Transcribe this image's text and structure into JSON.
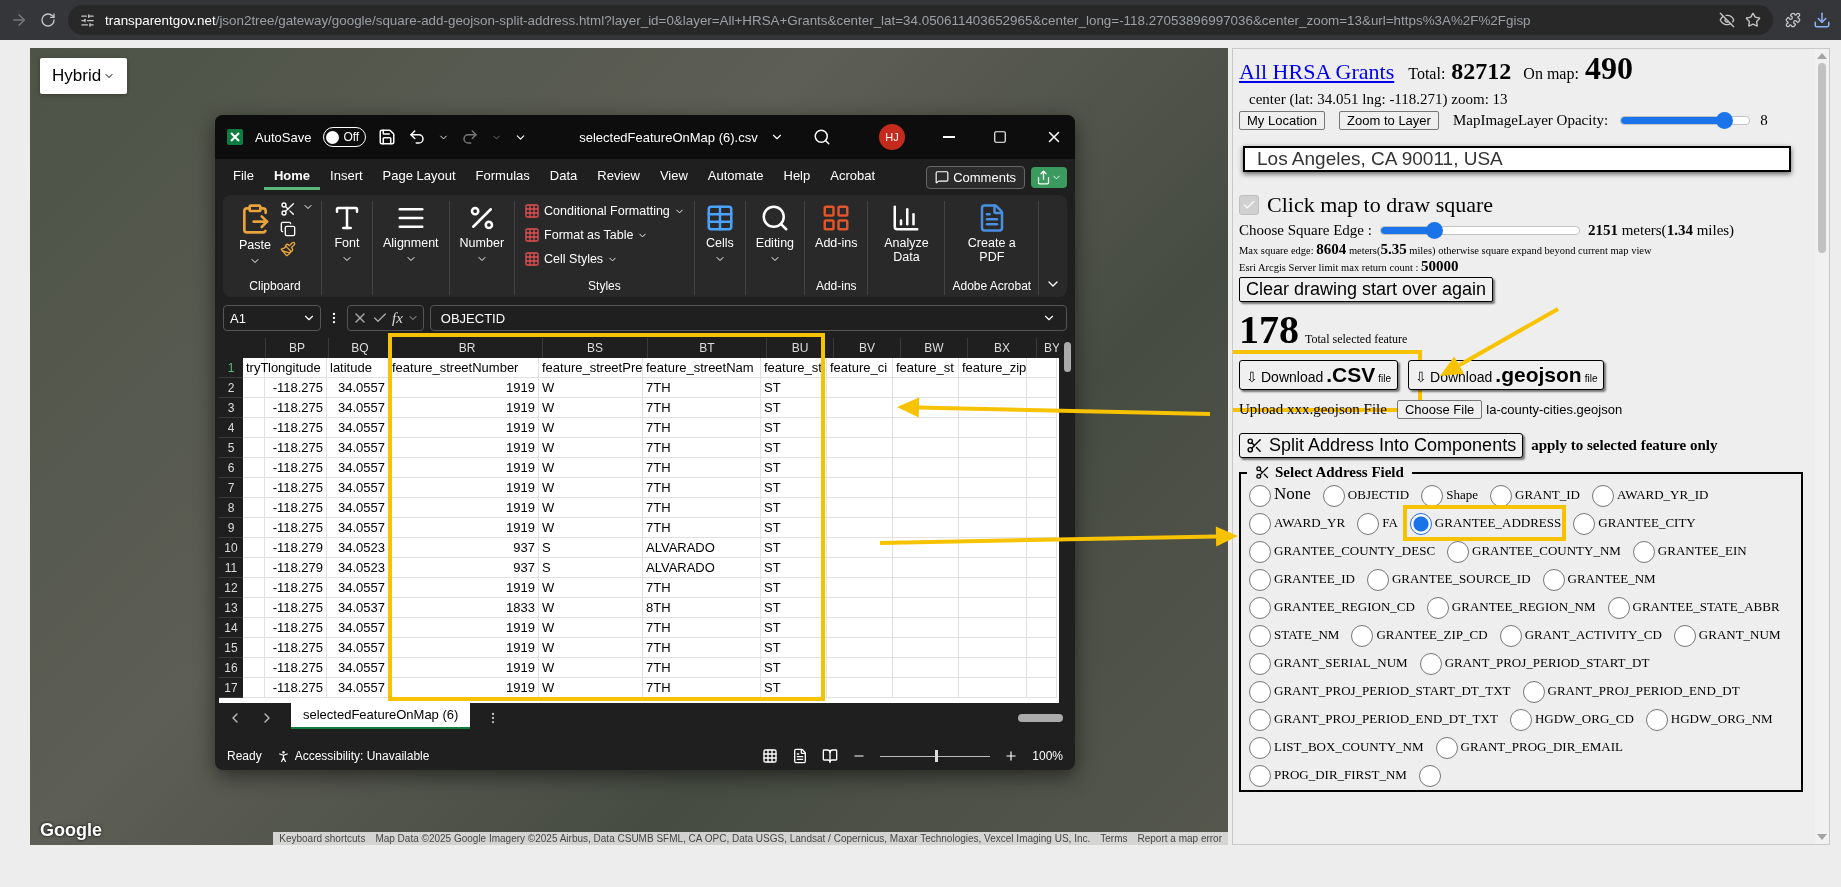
{
  "browser": {
    "host": "transparentgov.net",
    "path": "/json2tree/gateway/google/square-add-geojson-split-address.html?layer_id=0&layer=All+HRSA+Grants&center_lat=34.050611403652965&center_long=-118.27053896997036&center_zoom=13&url=https%3A%2F%2Fgisp"
  },
  "map": {
    "type_button": "Hybrid",
    "logo": "Google",
    "attribution": [
      "Keyboard shortcuts",
      "Map Data ©2025 Google Imagery ©2025 Airbus, Data CSUMB SFML, CA OPC, Data USGS, Landsat / Copernicus, Maxar Technologies, Vexcel Imaging US, Inc.",
      "Terms",
      "Report a map error"
    ]
  },
  "excel": {
    "autosave": {
      "label": "AutoSave",
      "toggle": "Off",
      "on": false
    },
    "file_name": "selectedFeatureOnMap (6).csv",
    "avatar": "HJ",
    "tabs": [
      {
        "label": "File",
        "selected": false
      },
      {
        "label": "Home",
        "selected": true
      },
      {
        "label": "Insert",
        "selected": false
      },
      {
        "label": "Page Layout",
        "selected": false
      },
      {
        "label": "Formulas",
        "selected": false
      },
      {
        "label": "Data",
        "selected": false
      },
      {
        "label": "Review",
        "selected": false
      },
      {
        "label": "View",
        "selected": false
      },
      {
        "label": "Automate",
        "selected": false
      },
      {
        "label": "Help",
        "selected": false
      },
      {
        "label": "Acrobat",
        "selected": false
      }
    ],
    "comments_button": "Comments",
    "ribbon": [
      {
        "kind": "clipboard",
        "button": "Paste",
        "label": "Clipboard"
      },
      {
        "kind": "font",
        "button": "Font"
      },
      {
        "kind": "alignment",
        "button": "Alignment"
      },
      {
        "kind": "number",
        "button": "Number"
      },
      {
        "kind": "styles",
        "items": [
          "Conditional Formatting",
          "Format as Table",
          "Cell Styles"
        ],
        "label": "Styles"
      },
      {
        "kind": "cells",
        "button": "Cells"
      },
      {
        "kind": "editing",
        "button": "Editing"
      },
      {
        "kind": "addins",
        "button": "Add-ins",
        "label": "Add-ins"
      },
      {
        "kind": "analyze",
        "button": "Analyze Data"
      },
      {
        "kind": "pdf",
        "button": "Create a PDF",
        "label": "Adobe Acrobat"
      }
    ],
    "formula_bar": {
      "name_box": "A1",
      "fx": "fx",
      "value": "OBJECTID"
    },
    "column_letters": [
      "BP",
      "BQ",
      "BR",
      "BS",
      "BT",
      "BU",
      "BV",
      "BW",
      "BX",
      "BY"
    ],
    "rows": [
      {
        "number": "1",
        "cells": [
          "tryT",
          "longitude",
          "latitude",
          "feature_streetNumber",
          "feature_streetPre",
          "feature_streetNam",
          "feature_st",
          "feature_ci",
          "feature_st",
          "feature_zip"
        ]
      },
      {
        "number": "2",
        "cells": [
          null,
          "-118.275",
          "34.0557",
          "1919",
          "W",
          "7TH",
          "ST"
        ]
      },
      {
        "number": "3",
        "cells": [
          null,
          "-118.275",
          "34.0557",
          "1919",
          "W",
          "7TH",
          "ST"
        ]
      },
      {
        "number": "4",
        "cells": [
          null,
          "-118.275",
          "34.0557",
          "1919",
          "W",
          "7TH",
          "ST"
        ]
      },
      {
        "number": "5",
        "cells": [
          null,
          "-118.275",
          "34.0557",
          "1919",
          "W",
          "7TH",
          "ST"
        ]
      },
      {
        "number": "6",
        "cells": [
          null,
          "-118.275",
          "34.0557",
          "1919",
          "W",
          "7TH",
          "ST"
        ]
      },
      {
        "number": "7",
        "cells": [
          null,
          "-118.275",
          "34.0557",
          "1919",
          "W",
          "7TH",
          "ST"
        ]
      },
      {
        "number": "8",
        "cells": [
          null,
          "-118.275",
          "34.0557",
          "1919",
          "W",
          "7TH",
          "ST"
        ]
      },
      {
        "number": "9",
        "cells": [
          null,
          "-118.275",
          "34.0557",
          "1919",
          "W",
          "7TH",
          "ST"
        ]
      },
      {
        "number": "10",
        "cells": [
          null,
          "-118.279",
          "34.0523",
          "937",
          "S",
          "ALVARADO",
          "ST"
        ]
      },
      {
        "number": "11",
        "cells": [
          null,
          "-118.279",
          "34.0523",
          "937",
          "S",
          "ALVARADO",
          "ST"
        ]
      },
      {
        "number": "12",
        "cells": [
          null,
          "-118.275",
          "34.0557",
          "1919",
          "W",
          "7TH",
          "ST"
        ]
      },
      {
        "number": "13",
        "cells": [
          null,
          "-118.275",
          "34.0537",
          "1833",
          "W",
          "8TH",
          "ST"
        ]
      },
      {
        "number": "14",
        "cells": [
          null,
          "-118.275",
          "34.0557",
          "1919",
          "W",
          "7TH",
          "ST"
        ]
      },
      {
        "number": "15",
        "cells": [
          null,
          "-118.275",
          "34.0557",
          "1919",
          "W",
          "7TH",
          "ST"
        ]
      },
      {
        "number": "16",
        "cells": [
          null,
          "-118.275",
          "34.0557",
          "1919",
          "W",
          "7TH",
          "ST"
        ]
      },
      {
        "number": "17",
        "cells": [
          null,
          "-118.275",
          "34.0557",
          "1919",
          "W",
          "7TH",
          "ST"
        ]
      }
    ],
    "sheet_tab": "selectedFeatureOnMap (6)",
    "status": {
      "ready": "Ready",
      "accessibility": "Accessibility: Unavailable",
      "zoom": "100%",
      "level": 0.5
    }
  },
  "panel": {
    "layer_link": "All HRSA Grants",
    "total_label": "Total:",
    "total": "82712",
    "on_map_label": "On map:",
    "on_map": "490",
    "center": "center (lat: 34.051 lng: -118.271) zoom: 13",
    "buttons": [
      "My Location",
      "Zoom to Layer"
    ],
    "opacity": {
      "label": "MapImageLayer Opacity:",
      "level": 0.8,
      "reading": "8"
    },
    "address": {
      "value": "Los Angeles, CA 90011, USA"
    },
    "draw_square": {
      "label": "Click map to draw square",
      "checked": true,
      "disabled": true
    },
    "square_edge": {
      "label": "Choose Square Edge :",
      "level": 0.27,
      "reading": "**2151** meters(**1.34** miles)"
    },
    "max_edge": "Max square edge: **8604** meters(**5.35** miles) otherwise square expand beyond current map view",
    "limit": "Esri Arcgis Server limit max return count : **50000**",
    "clear_button": "Clear drawing start over again",
    "selected_count": "178",
    "selected_label": "Total selected feature",
    "downloads": [
      {
        "arrow": "⇩",
        "label": "Download",
        "ext": ".CSV",
        "suffix": "file",
        "highlighted": true
      },
      {
        "arrow": "⇩",
        "label": "Download",
        "ext": ".geojson",
        "suffix": "file",
        "highlighted": false
      }
    ],
    "upload": {
      "label": "Upload xxx.geojson File",
      "button": "Choose File",
      "file": "la-county-cities.geojson"
    },
    "split_button": "Split Address Into Components",
    "split_note": "apply to selected feature only",
    "fieldset": {
      "legend": "Select Address Field",
      "options": [
        {
          "label": "None",
          "selected": false,
          "highlighted": false
        },
        {
          "label": "OBJECTID",
          "selected": false,
          "highlighted": false
        },
        {
          "label": "Shape",
          "selected": false,
          "highlighted": false
        },
        {
          "label": "GRANT_ID",
          "selected": false,
          "highlighted": false
        },
        {
          "label": "AWARD_YR_ID",
          "selected": false,
          "highlighted": false
        },
        {
          "label": "AWARD_YR",
          "selected": false,
          "highlighted": false
        },
        {
          "label": "FA",
          "selected": false,
          "highlighted": false
        },
        {
          "label": "GRANTEE_ADDRESS",
          "selected": true,
          "highlighted": true
        },
        {
          "label": "GRANTEE_CITY",
          "selected": false,
          "highlighted": false
        },
        {
          "label": "GRANTEE_COUNTY_DESC",
          "selected": false,
          "highlighted": false
        },
        {
          "label": "GRANTEE_COUNTY_NM",
          "selected": false,
          "highlighted": false
        },
        {
          "label": "GRANTEE_EIN",
          "selected": false,
          "highlighted": false
        },
        {
          "label": "GRANTEE_ID",
          "selected": false,
          "highlighted": false
        },
        {
          "label": "GRANTEE_SOURCE_ID",
          "selected": false,
          "highlighted": false
        },
        {
          "label": "GRANTEE_NM",
          "selected": false,
          "highlighted": false
        },
        {
          "label": "GRANTEE_REGION_CD",
          "selected": false,
          "highlighted": false
        },
        {
          "label": "GRANTEE_REGION_NM",
          "selected": false,
          "highlighted": false
        },
        {
          "label": "GRANTEE_STATE_ABBR",
          "selected": false,
          "highlighted": false
        },
        {
          "label": "STATE_NM",
          "selected": false,
          "highlighted": false
        },
        {
          "label": "GRANTEE_ZIP_CD",
          "selected": false,
          "highlighted": false
        },
        {
          "label": "GRANT_ACTIVITY_CD",
          "selected": false,
          "highlighted": false
        },
        {
          "label": "GRANT_NUM",
          "selected": false,
          "highlighted": false
        },
        {
          "label": "GRANT_SERIAL_NUM",
          "selected": false,
          "highlighted": false
        },
        {
          "label": "GRANT_PROJ_PERIOD_START_DT",
          "selected": false,
          "highlighted": false
        },
        {
          "label": "GRANT_PROJ_PERIOD_START_DT_TXT",
          "selected": false,
          "highlighted": false
        },
        {
          "label": "GRANT_PROJ_PERIOD_END_DT",
          "selected": false,
          "highlighted": false
        },
        {
          "label": "GRANT_PROJ_PERIOD_END_DT_TXT",
          "selected": false,
          "highlighted": false
        },
        {
          "label": "HGDW_ORG_CD",
          "selected": false,
          "highlighted": false
        },
        {
          "label": "HGDW_ORG_NM",
          "selected": false,
          "highlighted": false
        },
        {
          "label": "LIST_BOX_COUNTY_NM",
          "selected": false,
          "highlighted": false
        },
        {
          "label": "GRANT_PROG_DIR_EMAIL",
          "selected": false,
          "highlighted": false
        },
        {
          "label": "PROG_DIR_FIRST_NM",
          "selected": false,
          "highlighted": false
        },
        {
          "selected": false,
          "highlighted": false
        }
      ]
    }
  }
}
